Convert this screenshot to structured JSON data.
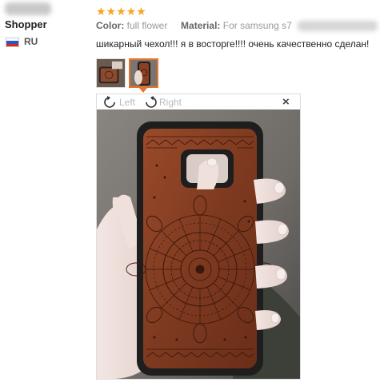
{
  "buyer": {
    "name": "Shopper",
    "country": "RU"
  },
  "review": {
    "stars": "★★★★★",
    "color_label": "Color:",
    "color_value": "full flower",
    "material_label": "Material:",
    "material_value": "For samsung s7",
    "text": "шикарный чехол!!! я в восторге!!!! очень качественно сделан!"
  },
  "viewer": {
    "rotate_left_label": "Left",
    "rotate_right_label": "Right",
    "close_label": "×"
  },
  "colors": {
    "star": "#f5a623",
    "thumb_active": "#e8742a",
    "wood": "#8b3f24",
    "case_frame": "#1e1e1e"
  }
}
